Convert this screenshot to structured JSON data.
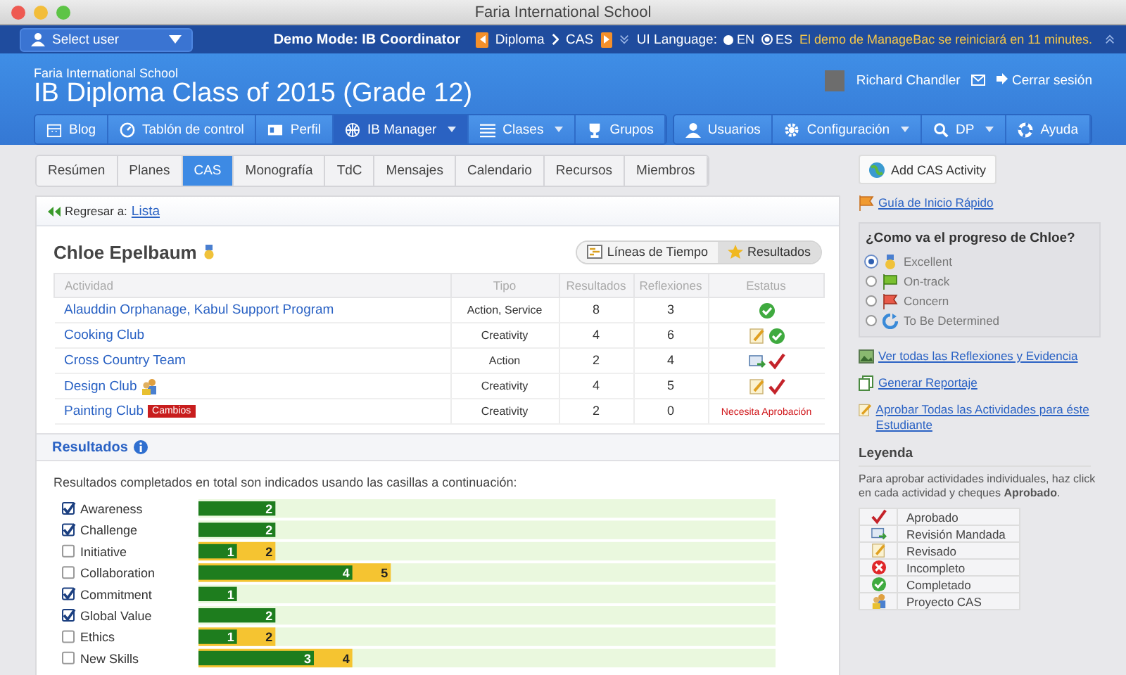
{
  "window": {
    "title": "Faria International School"
  },
  "topbar": {
    "user_select": "Select user",
    "demo_mode": "Demo Mode: IB Coordinator",
    "breadcrumb": [
      "Diploma",
      "CAS"
    ],
    "language_label": "UI Language:",
    "languages": [
      {
        "label": "EN",
        "selected": false
      },
      {
        "label": "ES",
        "selected": true
      }
    ],
    "notice": "El demo de ManageBac se reiniciará en 11 minutes."
  },
  "header": {
    "school": "Faria International School",
    "title": "IB Diploma Class of 2015 (Grade 12)",
    "user": "Richard Chandler",
    "logout": "Cerrar sesión"
  },
  "nav_left": [
    {
      "label": "Blog",
      "selected": false,
      "dropdown": false
    },
    {
      "label": "Tablón de control",
      "selected": false,
      "dropdown": false
    },
    {
      "label": "Perfil",
      "selected": false,
      "dropdown": false
    },
    {
      "label": "IB Manager",
      "selected": true,
      "dropdown": true
    },
    {
      "label": "Clases",
      "selected": false,
      "dropdown": true
    },
    {
      "label": "Grupos",
      "selected": false,
      "dropdown": false
    }
  ],
  "nav_right": [
    {
      "label": "Usuarios",
      "selected": false,
      "dropdown": false
    },
    {
      "label": "Configuración",
      "selected": false,
      "dropdown": true
    },
    {
      "label": "DP",
      "selected": false,
      "dropdown": true
    },
    {
      "label": "Ayuda",
      "selected": false,
      "dropdown": false
    }
  ],
  "tabs": [
    {
      "label": "Resúmen",
      "selected": false
    },
    {
      "label": "Planes",
      "selected": false
    },
    {
      "label": "CAS",
      "selected": true
    },
    {
      "label": "Monografía",
      "selected": false
    },
    {
      "label": "TdC",
      "selected": false
    },
    {
      "label": "Mensajes",
      "selected": false
    },
    {
      "label": "Calendario",
      "selected": false
    },
    {
      "label": "Recursos",
      "selected": false
    },
    {
      "label": "Miembros",
      "selected": false
    }
  ],
  "back": {
    "label": "Regresar a:",
    "link": "Lista"
  },
  "student": {
    "name": "Chloe Epelbaum",
    "views": [
      {
        "label": "Líneas de Tiempo",
        "selected": false
      },
      {
        "label": "Resultados",
        "selected": true
      }
    ]
  },
  "table": {
    "columns": [
      "Actividad",
      "Tipo",
      "Resultados",
      "Reflexiones",
      "Estatus"
    ],
    "rows": [
      {
        "activity": "Alauddin Orphanage, Kabul Support Program",
        "project": false,
        "type": "Action, Service",
        "outcomes": "8",
        "reflections": "3",
        "status": [
          {
            "kind": "completed"
          }
        ]
      },
      {
        "activity": "Cooking Club",
        "project": false,
        "type": "Creativity",
        "outcomes": "4",
        "reflections": "6",
        "status": [
          {
            "kind": "revised"
          },
          {
            "kind": "completed"
          }
        ]
      },
      {
        "activity": "Cross Country Team",
        "project": false,
        "type": "Action",
        "outcomes": "2",
        "reflections": "4",
        "status": [
          {
            "kind": "sent"
          },
          {
            "kind": "approved"
          }
        ]
      },
      {
        "activity": "Design Club",
        "project": true,
        "type": "Creativity",
        "outcomes": "4",
        "reflections": "5",
        "status": [
          {
            "kind": "revised"
          },
          {
            "kind": "approved"
          }
        ]
      },
      {
        "activity": "Painting Club",
        "project": false,
        "badge": "Cambios",
        "type": "Creativity",
        "outcomes": "2",
        "reflections": "0",
        "status_text": "Necesita Aprobación"
      }
    ]
  },
  "results": {
    "title": "Resultados",
    "caption": "Resultados completados en total son indicados usando las casillas a continuación:",
    "checks": [
      {
        "checked": true
      },
      {
        "checked": true
      },
      {
        "checked": false
      },
      {
        "checked": false
      },
      {
        "checked": true
      },
      {
        "checked": true
      },
      {
        "checked": false
      },
      {
        "checked": false
      }
    ],
    "chart_data": {
      "type": "bar",
      "orientation": "horizontal",
      "stacked": false,
      "xlim": [
        0,
        15
      ],
      "data_labels": true,
      "categories": [
        "Awareness",
        "Challenge",
        "Initiative",
        "Collaboration",
        "Commitment",
        "Global Value",
        "Ethics",
        "New Skills"
      ],
      "series": [
        {
          "color": "#1e7d1e",
          "values": [
            2,
            2,
            1,
            4,
            1,
            2,
            1,
            3
          ]
        },
        {
          "color": "#f5c431",
          "values": [
            null,
            null,
            2,
            5,
            null,
            null,
            2,
            4
          ]
        }
      ]
    }
  },
  "sidebar": {
    "add_button": "Add CAS Activity",
    "guide_link": "Guía de Inicio Rápido",
    "progress_title": "¿Como va el progreso de Chloe?",
    "progress": [
      {
        "label": "Excellent",
        "selected": true
      },
      {
        "label": "On-track",
        "selected": false
      },
      {
        "label": "Concern",
        "selected": false
      },
      {
        "label": "To Be Determined",
        "selected": false
      }
    ],
    "links": [
      "Ver todas las Reflexiones y Evidencia",
      "Generar Reportaje",
      "Aprobar Todas las Actividades para éste Estudiante"
    ],
    "legend_title": "Leyenda",
    "legend_text": "Para aprobar actividades individuales, haz click en cada actividad y cheques **Aprobado**.",
    "legend": [
      {
        "kind": "approved",
        "label": "Aprobado"
      },
      {
        "kind": "sent",
        "label": "Revisión Mandada"
      },
      {
        "kind": "revised",
        "label": "Revisado"
      },
      {
        "kind": "incomplete",
        "label": "Incompleto"
      },
      {
        "kind": "completed",
        "label": "Completado"
      },
      {
        "kind": "project",
        "label": "Proyecto CAS"
      }
    ]
  }
}
